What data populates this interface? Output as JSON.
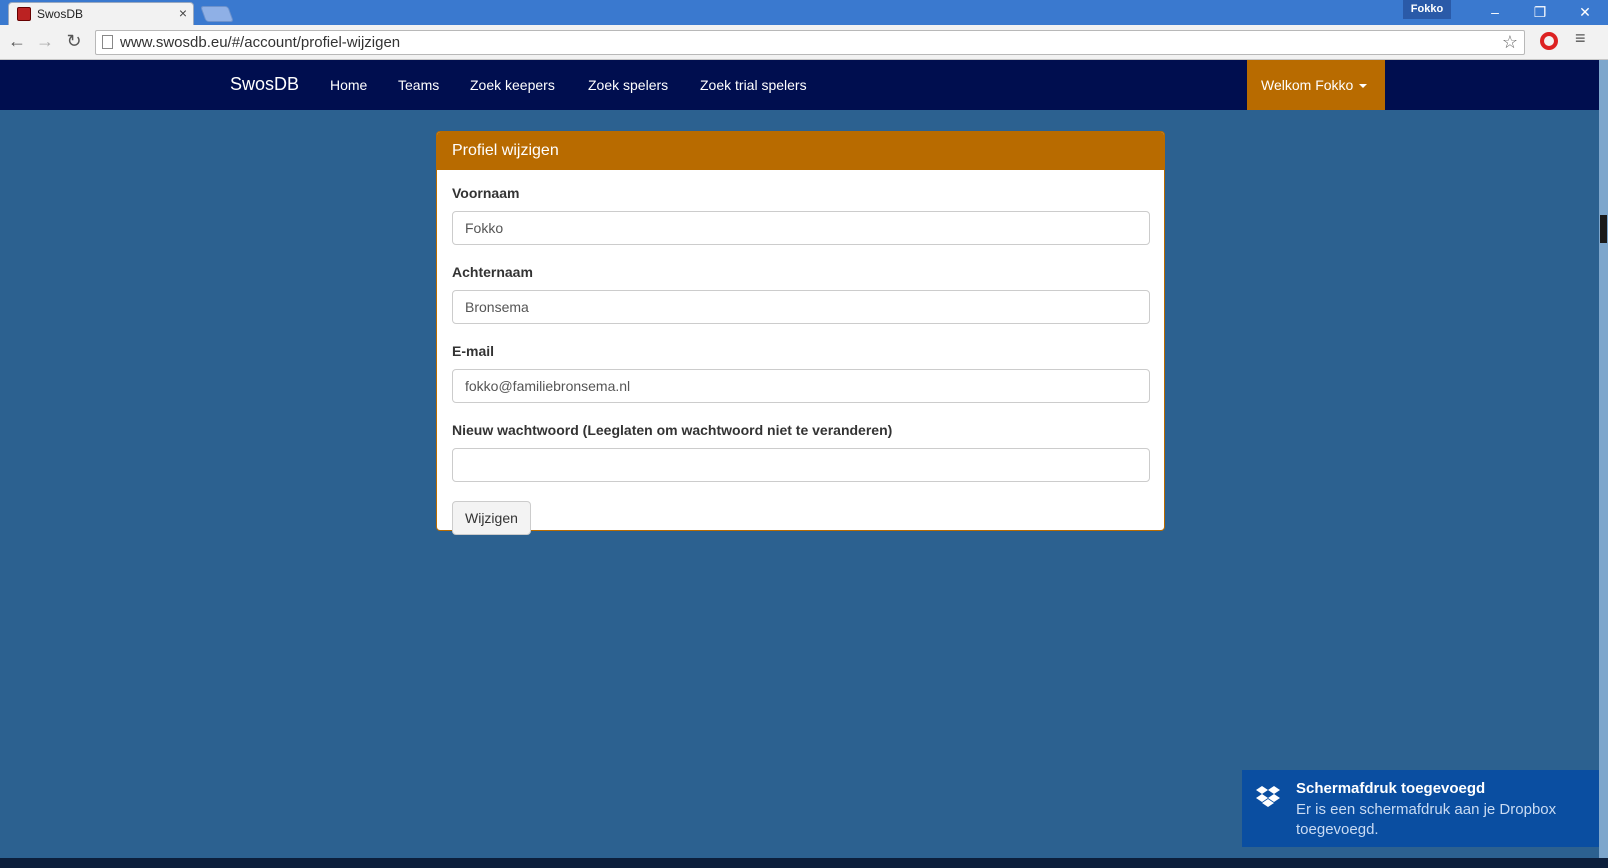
{
  "browser": {
    "tab_title": "SwosDB",
    "tab_close": "×",
    "profile_name": "Fokko",
    "url": "www.swosdb.eu/#/account/profiel-wijzigen",
    "window_controls": {
      "minimize": "–",
      "restore": "❐",
      "close": "✕"
    },
    "nav": {
      "back": "←",
      "forward": "→",
      "reload": "↻",
      "star": "☆",
      "menu": "≡"
    }
  },
  "navbar": {
    "brand": "SwosDB",
    "links": [
      "Home",
      "Teams",
      "Zoek keepers",
      "Zoek spelers",
      "Zoek trial spelers"
    ],
    "user_menu": "Welkom Fokko"
  },
  "panel": {
    "title": "Profiel wijzigen",
    "fields": [
      {
        "label": "Voornaam",
        "value": "Fokko"
      },
      {
        "label": "Achternaam",
        "value": "Bronsema"
      },
      {
        "label": "E-mail",
        "value": "fokko@familiebronsema.nl"
      },
      {
        "label": "Nieuw wachtwoord (Leeglaten om wachtwoord niet te veranderen)",
        "value": ""
      }
    ],
    "submit_label": "Wijzigen"
  },
  "toast": {
    "title": "Schermafdruk toegevoegd",
    "message": "Er is een schermafdruk aan je Dropbox toegevoegd."
  },
  "colors": {
    "page_bg": "#2c6190",
    "navbar_bg": "#000e4f",
    "accent": "#b86b00",
    "toast_bg": "#0a4ea1"
  }
}
